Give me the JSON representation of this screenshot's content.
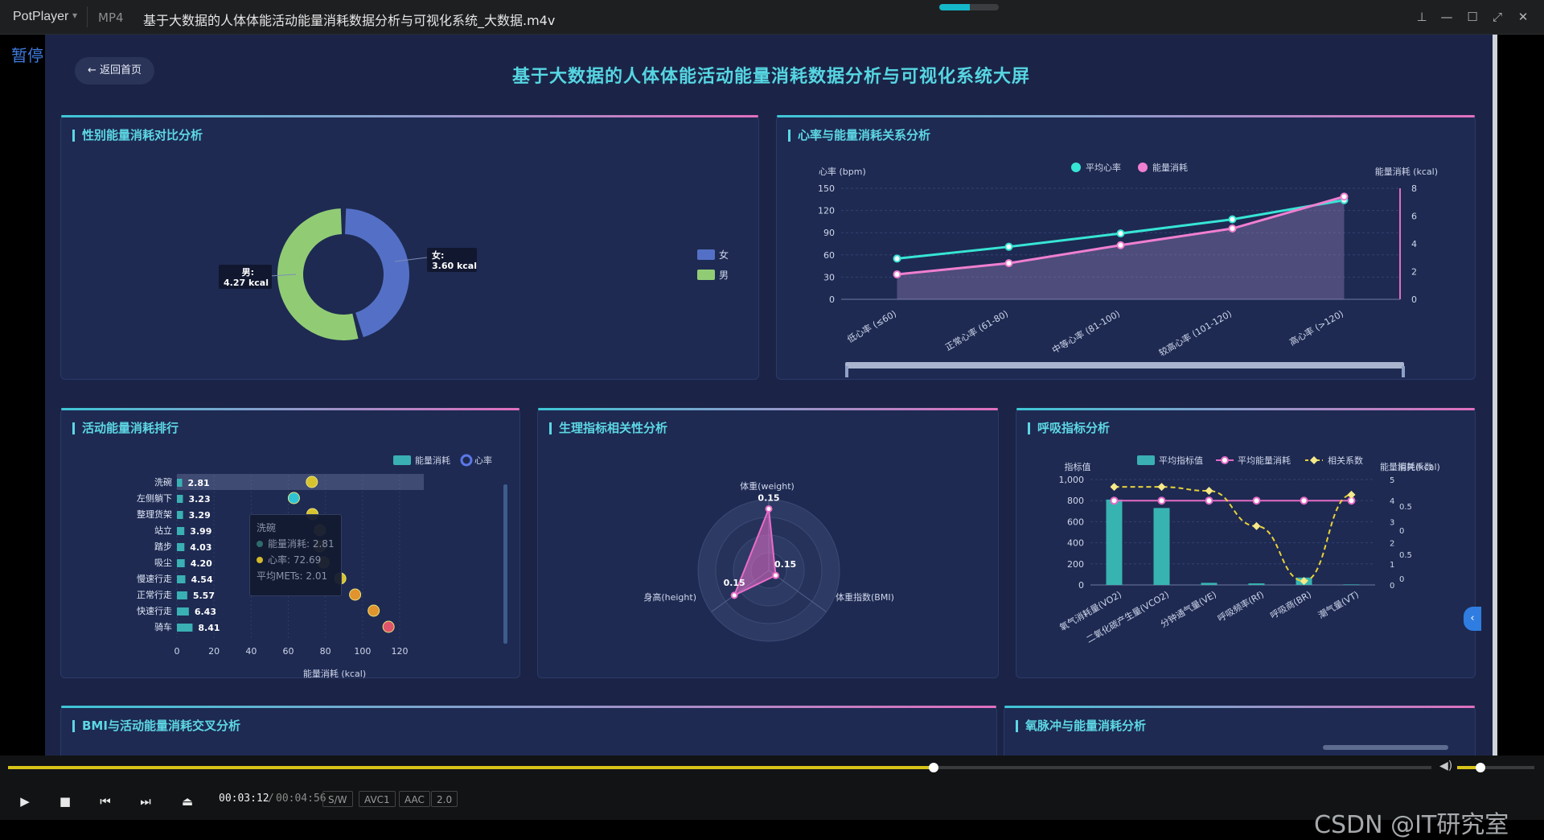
{
  "player": {
    "app_name": "PotPlayer",
    "format": "MP4",
    "file_title": "基于大数据的人体体能活动能量消耗数据分析与可视化系统_大数据.m4v",
    "pause_label": "暂停",
    "time_current": "00:03:12",
    "time_separator": "/",
    "time_total": "00:04:56",
    "tags": [
      "S/W",
      "AVC1",
      "AAC",
      "2.0"
    ],
    "progress": 0.65,
    "volume": 0.3
  },
  "dashboard": {
    "back_label": "返回首页",
    "title": "基于大数据的人体体能活动能量消耗数据分析与可视化系统大屏"
  },
  "panels": {
    "gender": "性别能量消耗对比分析",
    "heart": "心率与能量消耗关系分析",
    "activity": "活动能量消耗排行",
    "physio": "生理指标相关性分析",
    "resp": "呼吸指标分析",
    "bmi": "BMI与活动能量消耗交叉分析",
    "o2pulse": "氧脉冲与能量消耗分析"
  },
  "watermark": "CSDN @IT研究室",
  "colors": {
    "accent": "#56d6e2",
    "pink": "#e06fbf",
    "female": "#5470c6",
    "male": "#91cc75"
  },
  "chart_data": [
    {
      "id": "gender",
      "type": "pie",
      "labels": [
        "女",
        "男"
      ],
      "values": [
        3.6,
        4.27
      ],
      "data_labels": [
        {
          "name": "女:",
          "value": "3.60 kcal"
        },
        {
          "name": "男:",
          "value": "4.27 kcal"
        }
      ],
      "legend": [
        "女",
        "男"
      ]
    },
    {
      "id": "heart",
      "type": "line",
      "categories": [
        "低心率 (≤60)",
        "正常心率 (61-80)",
        "中等心率 (81-100)",
        "较高心率 (101-120)",
        "高心率 (>120)"
      ],
      "legend": [
        "平均心率",
        "能量消耗"
      ],
      "series": [
        {
          "name": "平均心率",
          "values": [
            55,
            71,
            89,
            108,
            134
          ]
        },
        {
          "name": "能量消耗",
          "values": [
            1.8,
            2.6,
            3.9,
            5.1,
            7.4
          ]
        }
      ],
      "ylabel_left": "心率 (bpm)",
      "ylabel_right": "能量消耗 (kcal)",
      "y_left_ticks": [
        "0",
        "30",
        "60",
        "90",
        "120",
        "150"
      ],
      "y_right_ticks": [
        "0",
        "2",
        "4",
        "6",
        "8"
      ],
      "ylim_left": [
        0,
        150
      ],
      "ylim_right": [
        0,
        8
      ]
    },
    {
      "id": "activity",
      "type": "bar",
      "categories": [
        "洗碗",
        "左侧躺下",
        "整理货架",
        "站立",
        "踏步",
        "吸尘",
        "慢速行走",
        "正常行走",
        "快速行走",
        "骑车"
      ],
      "energy": [
        2.81,
        3.23,
        3.29,
        3.99,
        4.03,
        4.2,
        4.54,
        5.57,
        6.43,
        8.41
      ],
      "energy_labels": [
        "2.81",
        "3.23",
        "3.29",
        "3.99",
        "4.03",
        "4.20",
        "4.54",
        "5.57",
        "6.43",
        "8.41"
      ],
      "heart_rate": [
        72.69,
        63,
        73,
        77,
        77,
        79,
        88,
        96,
        106,
        114
      ],
      "legend": [
        "能量消耗",
        "心率"
      ],
      "x_ticks": [
        "0",
        "20",
        "40",
        "60",
        "80",
        "100",
        "120"
      ],
      "xlabel": "能量消耗 (kcal)",
      "tooltip": {
        "title": "洗碗",
        "energy": "能量消耗: 2.81",
        "hr": "心率: 72.69",
        "mets": "平均METs: 2.01"
      }
    },
    {
      "id": "physio",
      "type": "radar",
      "indicators": [
        "体重(weight)",
        "体重指数(BMI)",
        "身高(height)"
      ],
      "values": [
        0.15,
        0.15,
        0.15
      ],
      "value_labels": [
        "0.15",
        "0.15",
        "0.15"
      ]
    },
    {
      "id": "resp",
      "type": "bar",
      "categories": [
        "氧气消耗量(VO2)",
        "二氧化碳产生量(VCO2)",
        "分钟通气量(VE)",
        "呼吸频率(Rf)",
        "呼吸商(BR)",
        "潮气量(VT)"
      ],
      "legend": [
        "平均指标值",
        "平均能量消耗",
        "相关系数"
      ],
      "series": [
        {
          "name": "平均指标值",
          "values": [
            810,
            730,
            20,
            15,
            70,
            5
          ]
        },
        {
          "name": "平均能量消耗",
          "values": [
            4,
            4,
            4,
            4,
            4,
            4
          ]
        },
        {
          "name": "相关系数",
          "values": [
            0.5,
            0.5,
            0.48,
            0.3,
            0.02,
            0.46
          ]
        }
      ],
      "ylabel_left": "指标值",
      "y_left_ticks": [
        "0",
        "200",
        "400",
        "600",
        "800",
        "1,000"
      ],
      "ylim_left": [
        0,
        1000
      ],
      "right_axis_label": "能量消耗(kcal)",
      "right_axis_label_overlap": "相关系数",
      "right_ticks_a": [
        "0",
        "1",
        "2",
        "3",
        "4",
        "5"
      ],
      "right_ticks_b": [
        "0",
        "0.5",
        "0",
        "0.5"
      ]
    }
  ]
}
